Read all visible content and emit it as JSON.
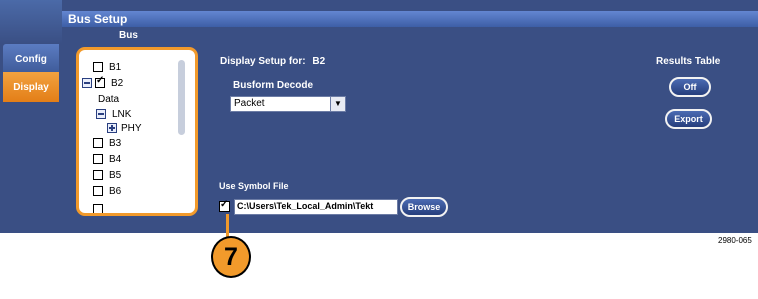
{
  "window": {
    "title": "Bus Setup"
  },
  "tabs": [
    {
      "label": "Config",
      "active": false
    },
    {
      "label": "Display",
      "active": true
    }
  ],
  "bus_panel": {
    "header": "Bus",
    "items": [
      {
        "label": "B1",
        "checked": false
      },
      {
        "label": "B2",
        "checked": true,
        "expanded": true
      },
      {
        "label": "Data"
      },
      {
        "label": "LNK",
        "expanded": true
      },
      {
        "label": "PHY",
        "expanded": false
      },
      {
        "label": "B3",
        "checked": false
      },
      {
        "label": "B4",
        "checked": false
      },
      {
        "label": "B5",
        "checked": false
      },
      {
        "label": "B6",
        "checked": false
      }
    ]
  },
  "display_setup": {
    "heading_prefix": "Display Setup for:",
    "heading_bus": "B2",
    "busform_label": "Busform Decode",
    "busform_value": "Packet"
  },
  "results_table": {
    "label": "Results Table",
    "toggle_label": "Off",
    "export_label": "Export"
  },
  "symbol_file": {
    "label": "Use Symbol File",
    "checked": true,
    "path": "C:\\Users\\Tek_Local_Admin\\Tekt",
    "browse_label": "Browse"
  },
  "callout": {
    "number": "7"
  },
  "figure_id": "2980-065",
  "colors": {
    "panel": "#3a4f84",
    "title_bar": "#4b6aa8",
    "accent_orange": "#f29a2b"
  }
}
